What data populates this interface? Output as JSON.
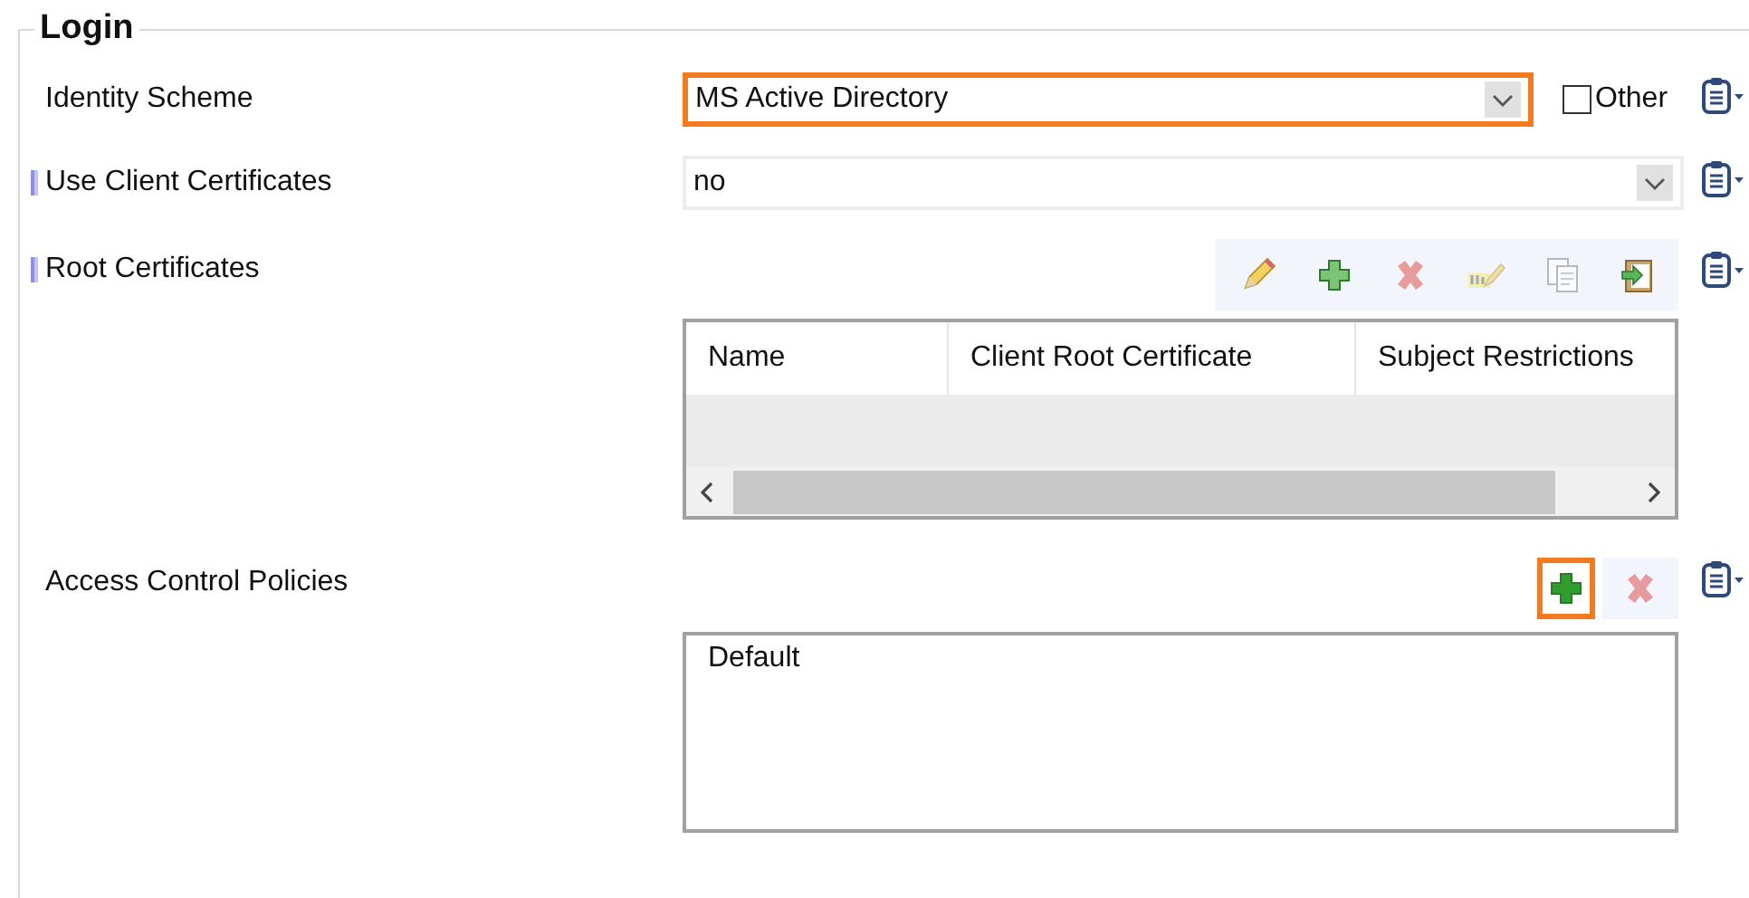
{
  "group": {
    "title": "Login"
  },
  "fields": [
    {
      "kind": "dropdown",
      "label": "Identity Scheme",
      "marked": false,
      "value": "MS Active Directory",
      "highlighted": true,
      "option": {
        "label": "Other",
        "checked": false
      }
    },
    {
      "kind": "dropdown",
      "label": "Use Client Certificates",
      "marked": true,
      "value": "no",
      "highlighted": false
    },
    {
      "kind": "table",
      "label": "Root Certificates",
      "marked": true,
      "toolbar": [
        {
          "kind": "edit",
          "disabled": false,
          "highlighted": false
        },
        {
          "kind": "add",
          "disabled": false,
          "highlighted": false
        },
        {
          "kind": "delete",
          "disabled": true,
          "highlighted": false
        },
        {
          "kind": "rename",
          "disabled": true,
          "highlighted": false
        },
        {
          "kind": "copy",
          "disabled": true,
          "highlighted": false
        },
        {
          "kind": "paste",
          "disabled": false,
          "highlighted": false
        }
      ],
      "columns": [
        "Name",
        "Client Root Certificate",
        "Subject Restrictions"
      ]
    },
    {
      "kind": "list",
      "label": "Access Control Policies",
      "marked": false,
      "toolbar": [
        {
          "kind": "add",
          "disabled": false,
          "highlighted": true
        },
        {
          "kind": "delete",
          "disabled": true,
          "highlighted": false
        }
      ],
      "items": [
        "Default"
      ]
    }
  ]
}
